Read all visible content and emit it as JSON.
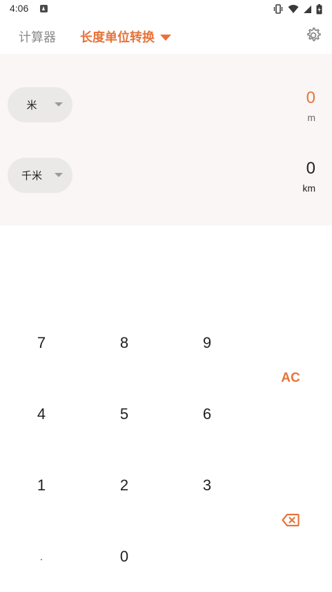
{
  "status_bar": {
    "time": "4:06",
    "icons": [
      "notification-a-icon",
      "vibrate-icon",
      "wifi-icon",
      "signal-icon",
      "battery-icon"
    ]
  },
  "header": {
    "tab_calculator": "计算器",
    "tab_unit_converter": "长度单位转换",
    "settings_icon": "gear-icon"
  },
  "converter": {
    "from": {
      "unit_label": "米",
      "value": "0",
      "unit_abbr": "m",
      "value_color": "#e8733a"
    },
    "to": {
      "unit_label": "千米",
      "value": "0",
      "unit_abbr": "km",
      "value_color": "#1f1f1f"
    }
  },
  "keypad": {
    "k7": "7",
    "k8": "8",
    "k9": "9",
    "k4": "4",
    "k5": "5",
    "k6": "6",
    "k1": "1",
    "k2": "2",
    "k3": "3",
    "kdot": ".",
    "k0": "0",
    "clear": "AC",
    "backspace_icon": "backspace-icon"
  },
  "colors": {
    "accent": "#e8733a",
    "panel_bg": "#f9f6f5",
    "select_bg": "#ebe8e8"
  }
}
